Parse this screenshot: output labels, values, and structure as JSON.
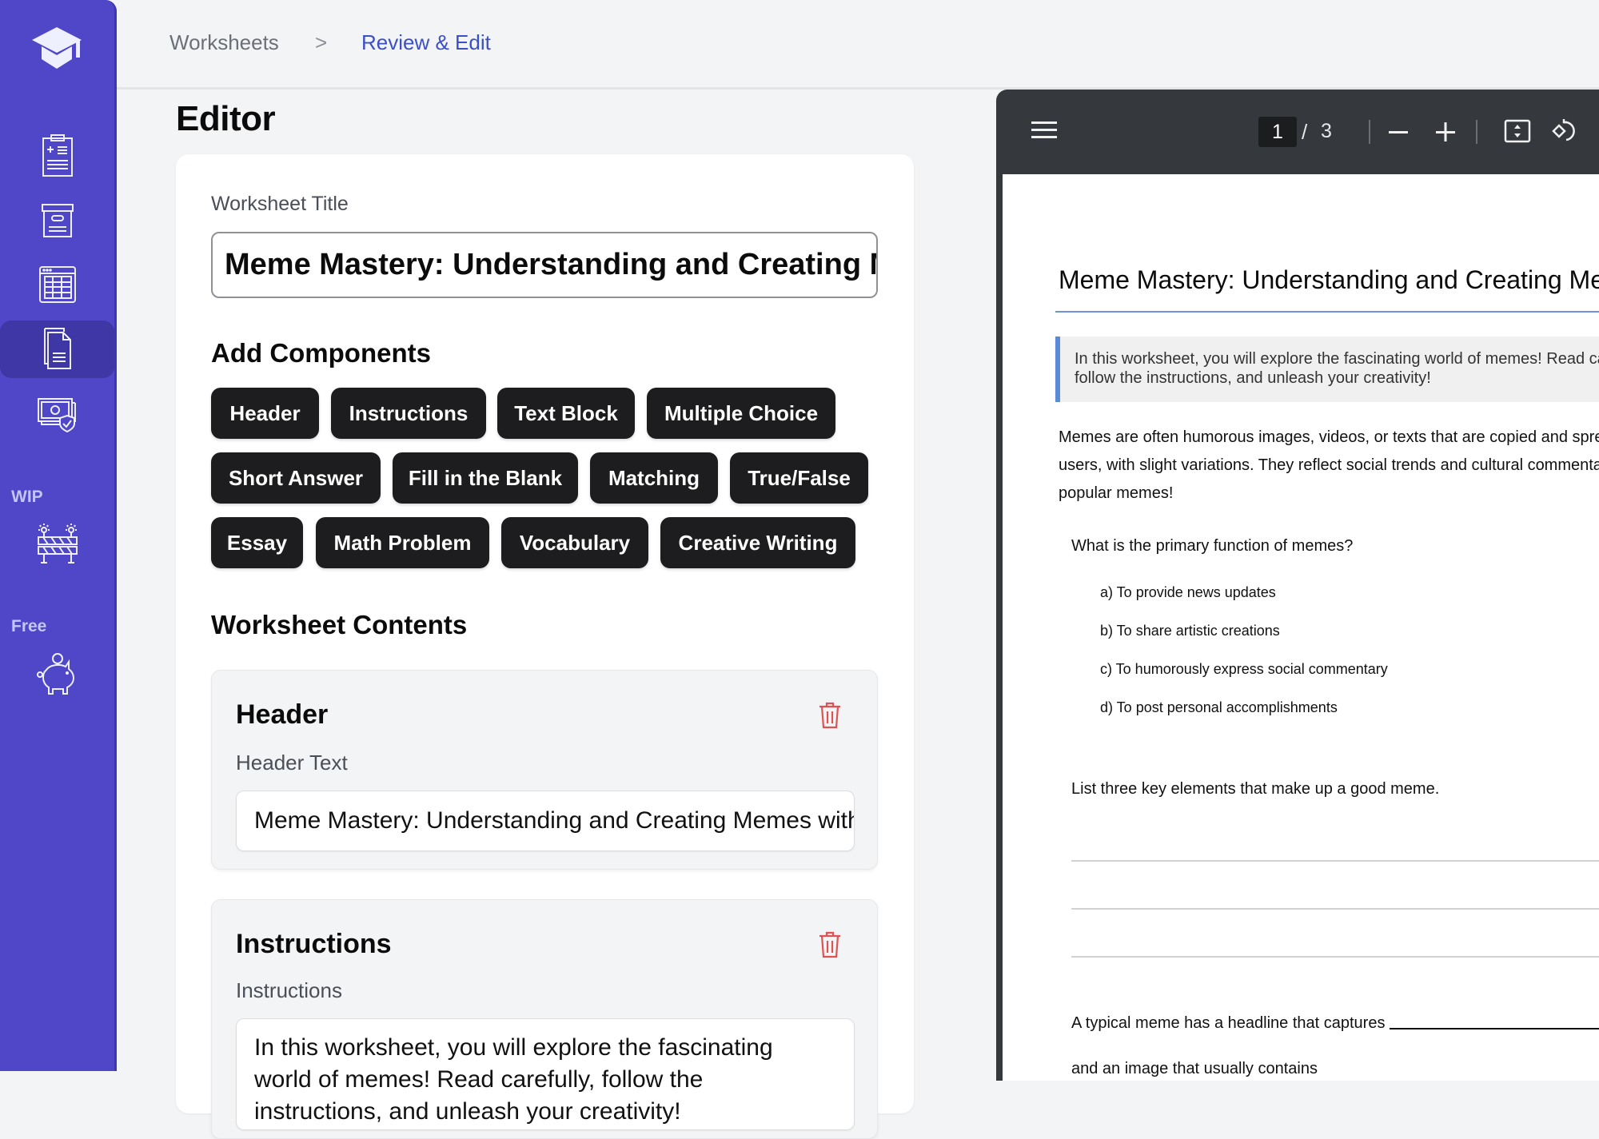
{
  "sidebar": {
    "logo": "graduation-cap-icon",
    "items": [
      {
        "icon": "clipboard-add-icon",
        "active": false
      },
      {
        "icon": "archive-box-icon",
        "active": false
      },
      {
        "icon": "table-icon",
        "active": false
      },
      {
        "icon": "documents-icon",
        "active": true
      },
      {
        "icon": "money-shield-icon",
        "active": false
      }
    ],
    "sections": [
      {
        "label": "WIP",
        "icon": "construction-barrier-icon"
      },
      {
        "label": "Free",
        "icon": "piggy-bank-icon"
      }
    ]
  },
  "breadcrumb": {
    "items": [
      "Worksheets",
      "Review & Edit"
    ],
    "separator": ">"
  },
  "editor": {
    "title": "Editor",
    "worksheet_title_label": "Worksheet Title",
    "worksheet_title_value": "Meme Mastery: Understanding and Creating Memes with Purpose",
    "add_components_heading": "Add Components",
    "components": [
      "Header",
      "Instructions",
      "Text Block",
      "Multiple Choice",
      "Short Answer",
      "Fill in the Blank",
      "Matching",
      "True/False",
      "Essay",
      "Math Problem",
      "Vocabulary",
      "Creative Writing"
    ],
    "contents_heading": "Worksheet Contents",
    "blocks": [
      {
        "type": "Header",
        "field_label": "Header Text",
        "value": "Meme Mastery: Understanding and Creating Memes with Purpose"
      },
      {
        "type": "Instructions",
        "field_label": "Instructions",
        "value": "In this worksheet, you will explore the fascinating world of memes! Read carefully, follow the instructions, and unleash your creativity!"
      }
    ]
  },
  "pdf_viewer": {
    "current_page": "1",
    "page_separator": "/",
    "total_pages": "3",
    "toolbar_icons": [
      "menu-icon",
      "zoom-out-icon",
      "zoom-in-icon",
      "fit-page-icon",
      "rotate-icon"
    ],
    "document": {
      "title": "Meme Mastery: Understanding and Creating Memes with Purpose",
      "instructions_line1": "In this worksheet, you will explore the fascinating world of memes! Read carefully,",
      "instructions_line2": "follow the instructions, and unleash your creativity!",
      "paragraph_line1": "Memes are often humorous images, videos, or texts that are copied and spread by internet",
      "paragraph_line2": "users, with slight variations. They reflect social trends and cultural commentary. Let's explore",
      "paragraph_line3": "popular memes!",
      "mc_question": "What is the primary function of memes?",
      "mc_options": [
        "a) To provide news updates",
        "b) To share artistic creations",
        "c) To humorously express social commentary",
        "d) To post personal accomplishments"
      ],
      "short_answer_question": "List three key elements that make up a good meme.",
      "fill_blank_prefix": "A typical meme has a headline that captures",
      "fill_blank_next": "and an image that usually contains"
    }
  }
}
